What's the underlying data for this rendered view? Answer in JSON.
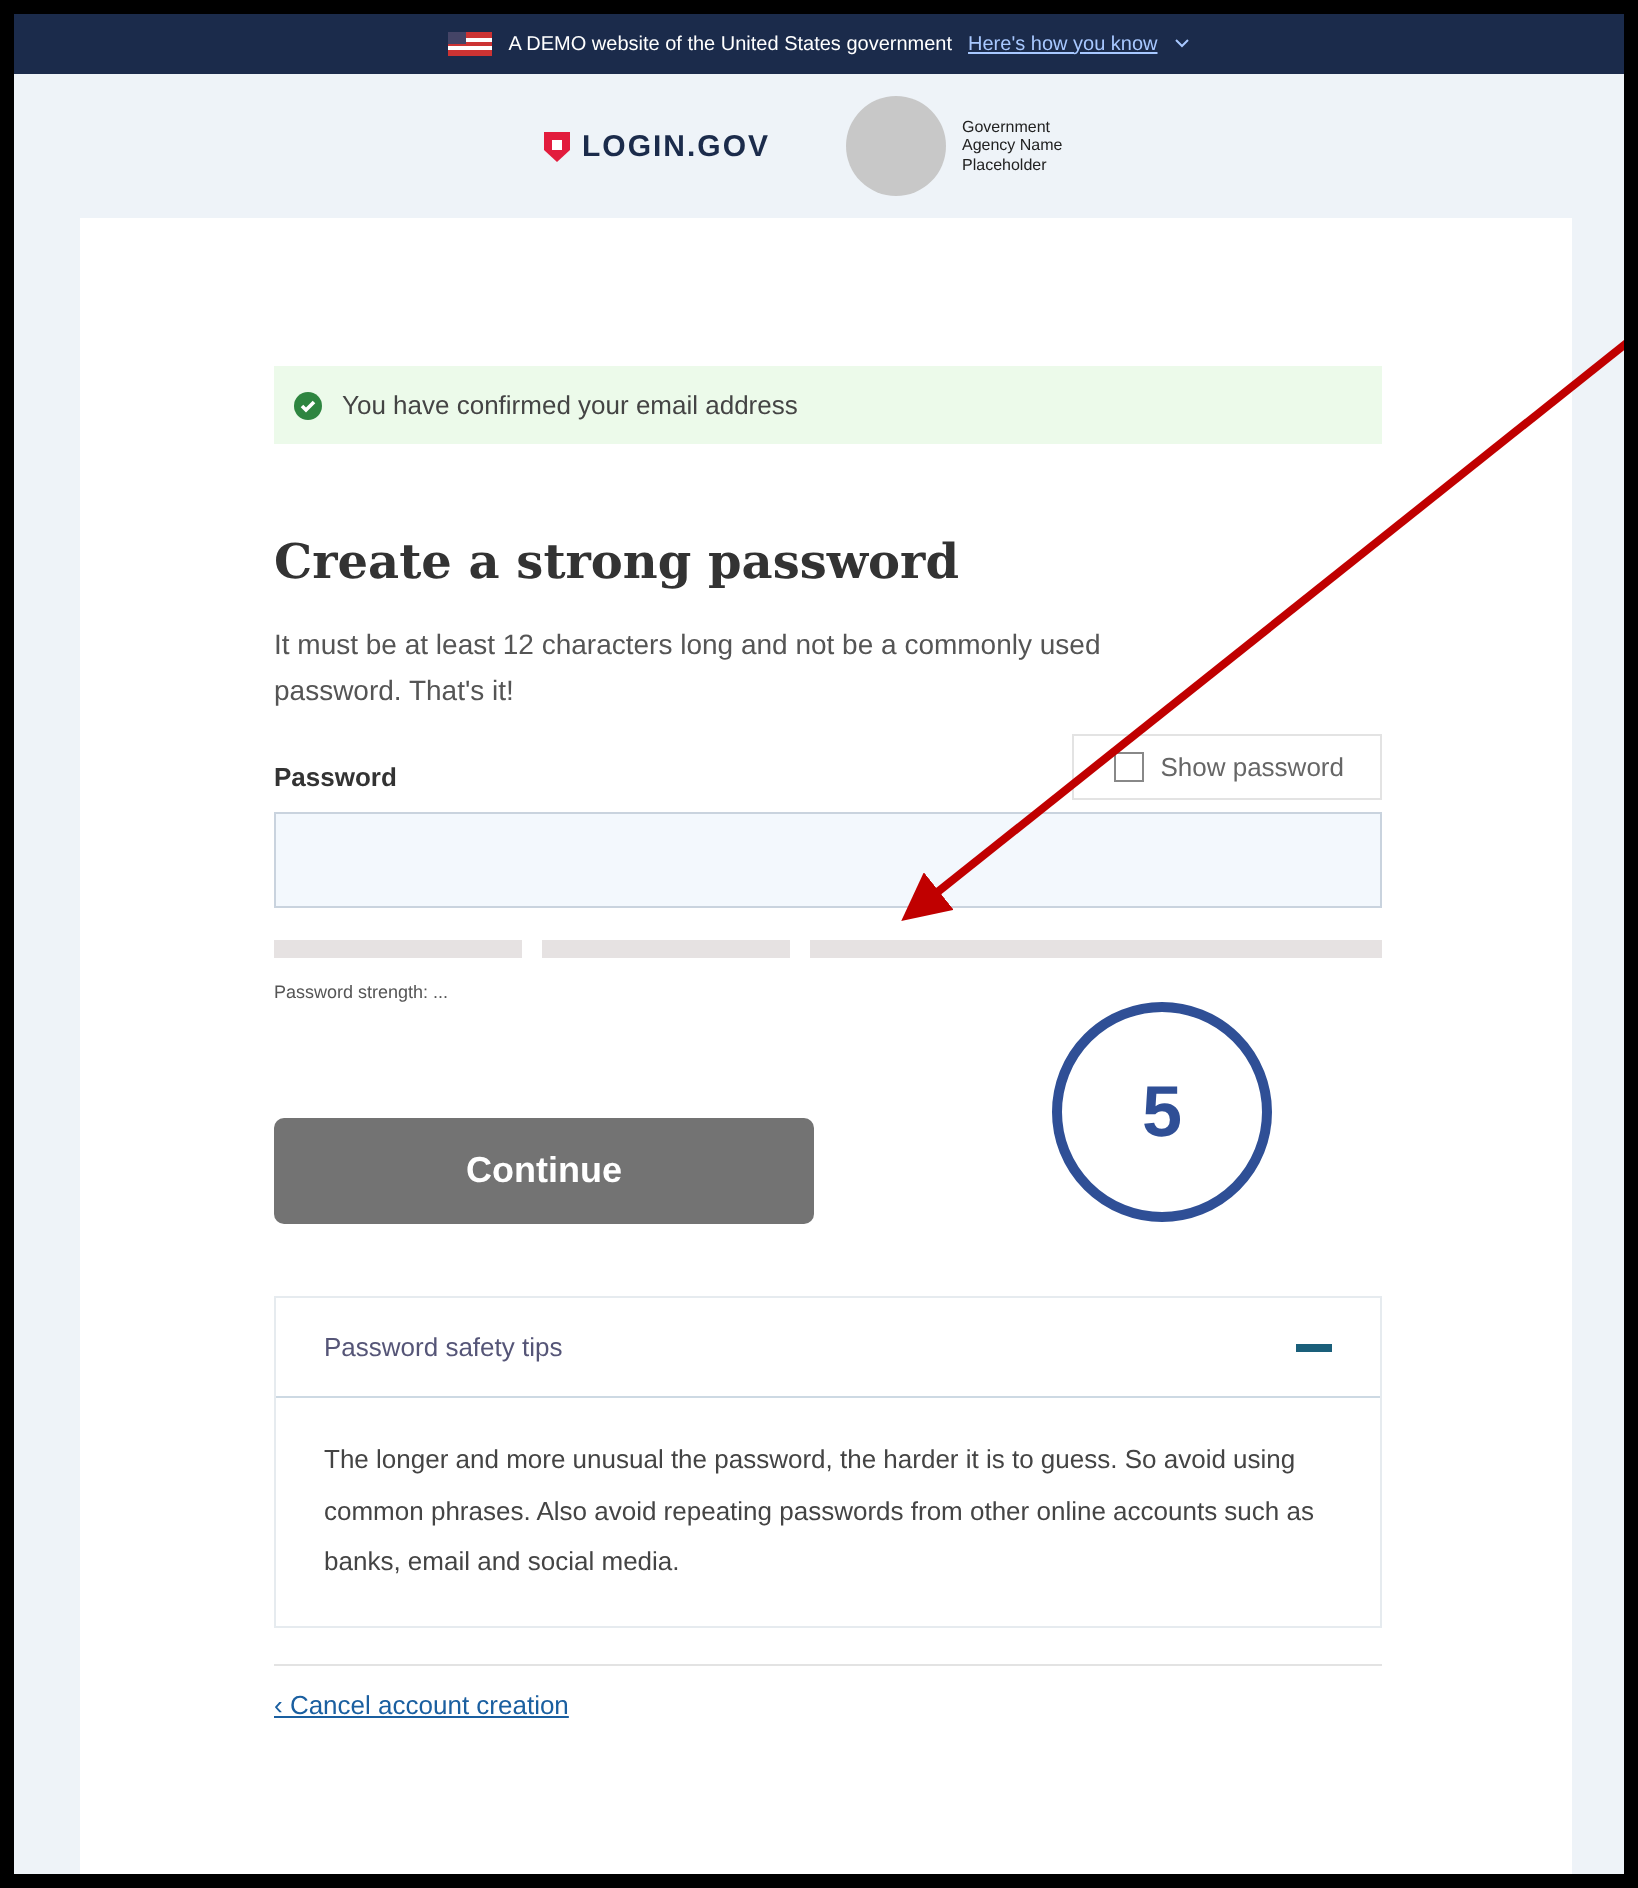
{
  "banner": {
    "text": "A DEMO website of the United States government",
    "link": "Here's how you know"
  },
  "header": {
    "logo": "LOGIN.GOV",
    "agency": "Government Agency Name Placeholder"
  },
  "alert": {
    "text": "You have confirmed your email address"
  },
  "heading": "Create a strong password",
  "intro": "It must be at least 12 characters long and not be a commonly used password. That's it!",
  "show_password": {
    "label": "Show password",
    "checked": false
  },
  "password": {
    "label": "Password"
  },
  "strength": {
    "text": "Password strength: ..."
  },
  "continue_button": "Continue",
  "accordion": {
    "title": "Password safety tips",
    "expanded": true,
    "body": "The longer and more unusual the password, the harder it is to guess. So avoid using common phrases. Also avoid repeating passwords from other online accounts such as banks, email and social media."
  },
  "cancel_link": "‹ Cancel account creation",
  "annotation": {
    "number": "5"
  }
}
